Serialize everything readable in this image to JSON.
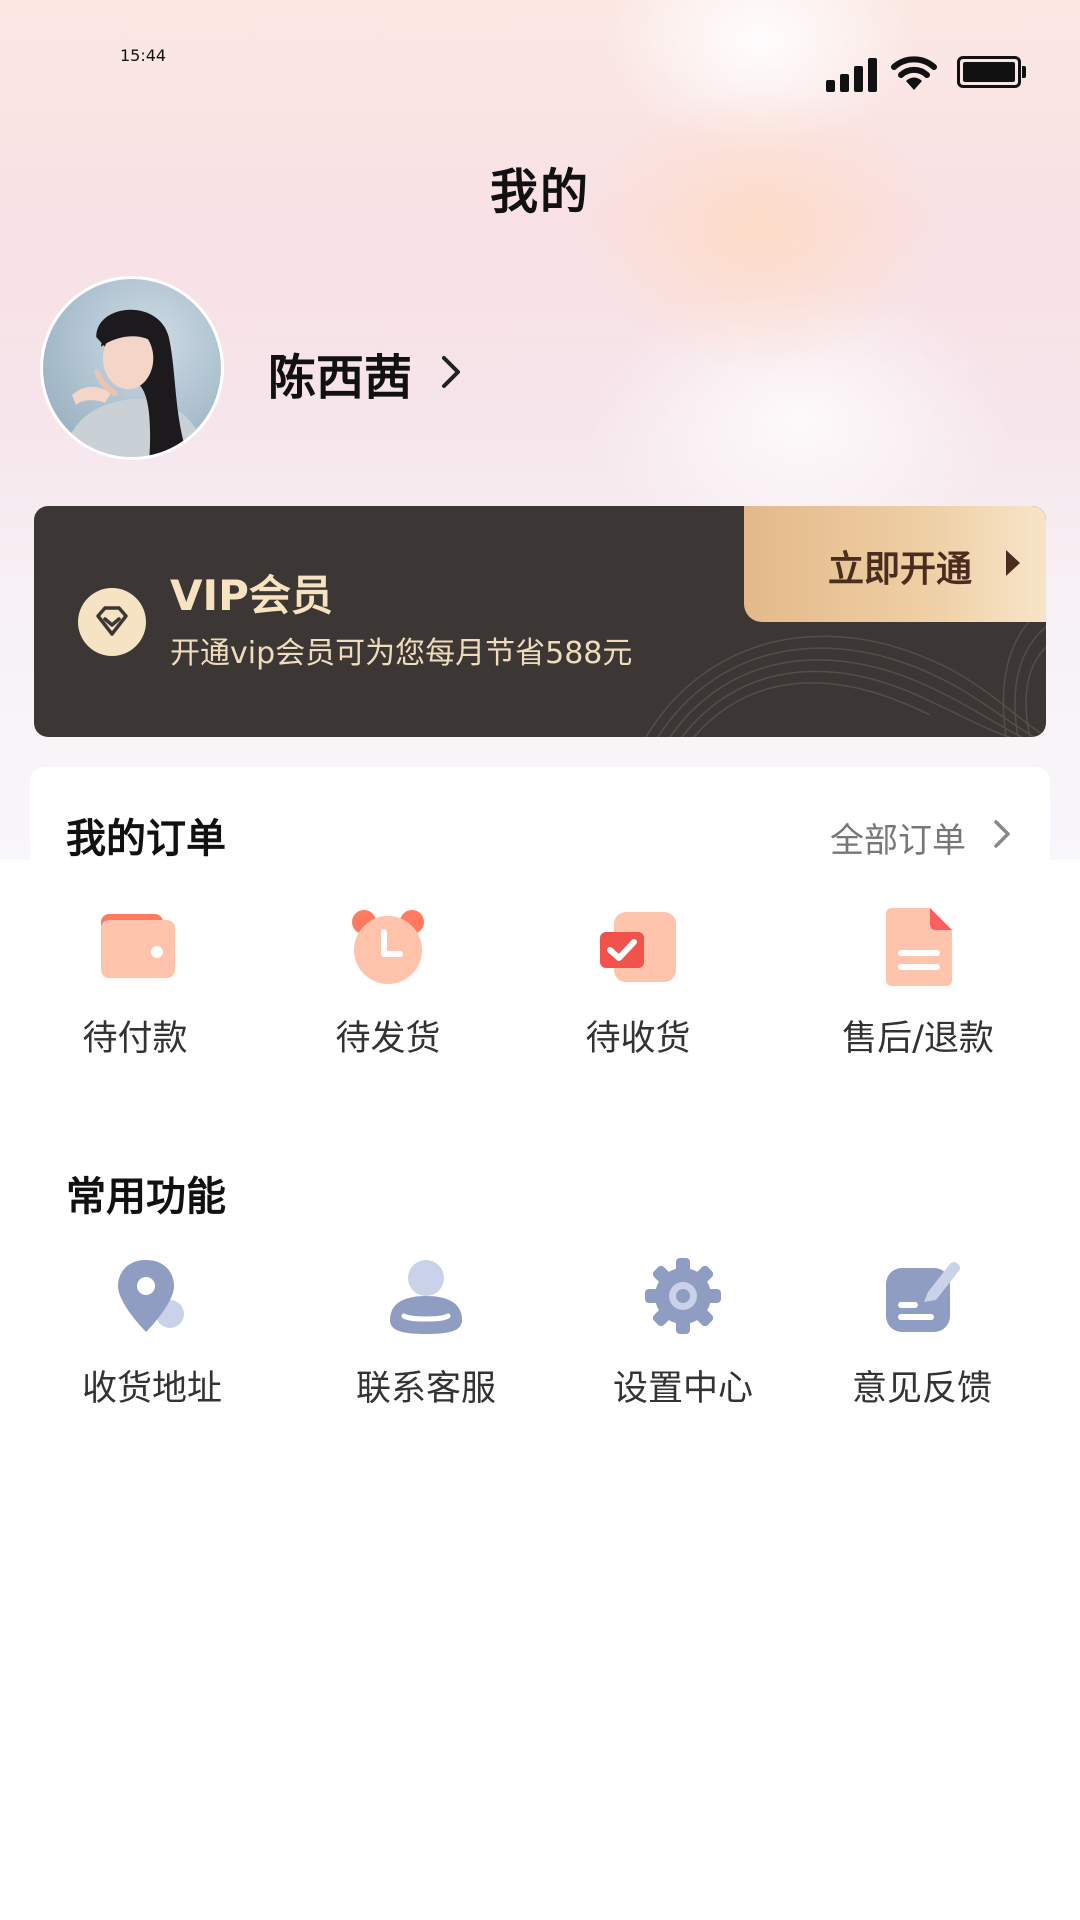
{
  "status_bar": {
    "time": "15:44"
  },
  "header": {
    "title": "我的"
  },
  "profile": {
    "username": "陈西茜"
  },
  "vip": {
    "title": "VIP会员",
    "description": "开通vip会员可为您每月节省588元",
    "button_label": "立即开通"
  },
  "orders": {
    "title": "我的订单",
    "all_label": "全部订单",
    "items": [
      {
        "label": "待付款",
        "icon": "wallet-icon"
      },
      {
        "label": "待发货",
        "icon": "alarm-clock-icon"
      },
      {
        "label": "待收货",
        "icon": "checked-package-icon"
      },
      {
        "label": "售后/退款",
        "icon": "document-icon"
      }
    ]
  },
  "functions": {
    "title": "常用功能",
    "items": [
      {
        "label": "收货地址",
        "icon": "location-pin-icon"
      },
      {
        "label": "联系客服",
        "icon": "person-icon"
      },
      {
        "label": "设置中心",
        "icon": "gear-icon"
      },
      {
        "label": "意见反馈",
        "icon": "feedback-icon"
      }
    ]
  },
  "colors": {
    "vip_card": "#3c3734",
    "vip_gold": "#f7e3c0",
    "order_icon_primary": "#ff6f5a",
    "order_icon_secondary": "#ffc0a8",
    "function_icon_primary": "#8f9dc2",
    "function_icon_secondary": "#c9d2e8"
  }
}
